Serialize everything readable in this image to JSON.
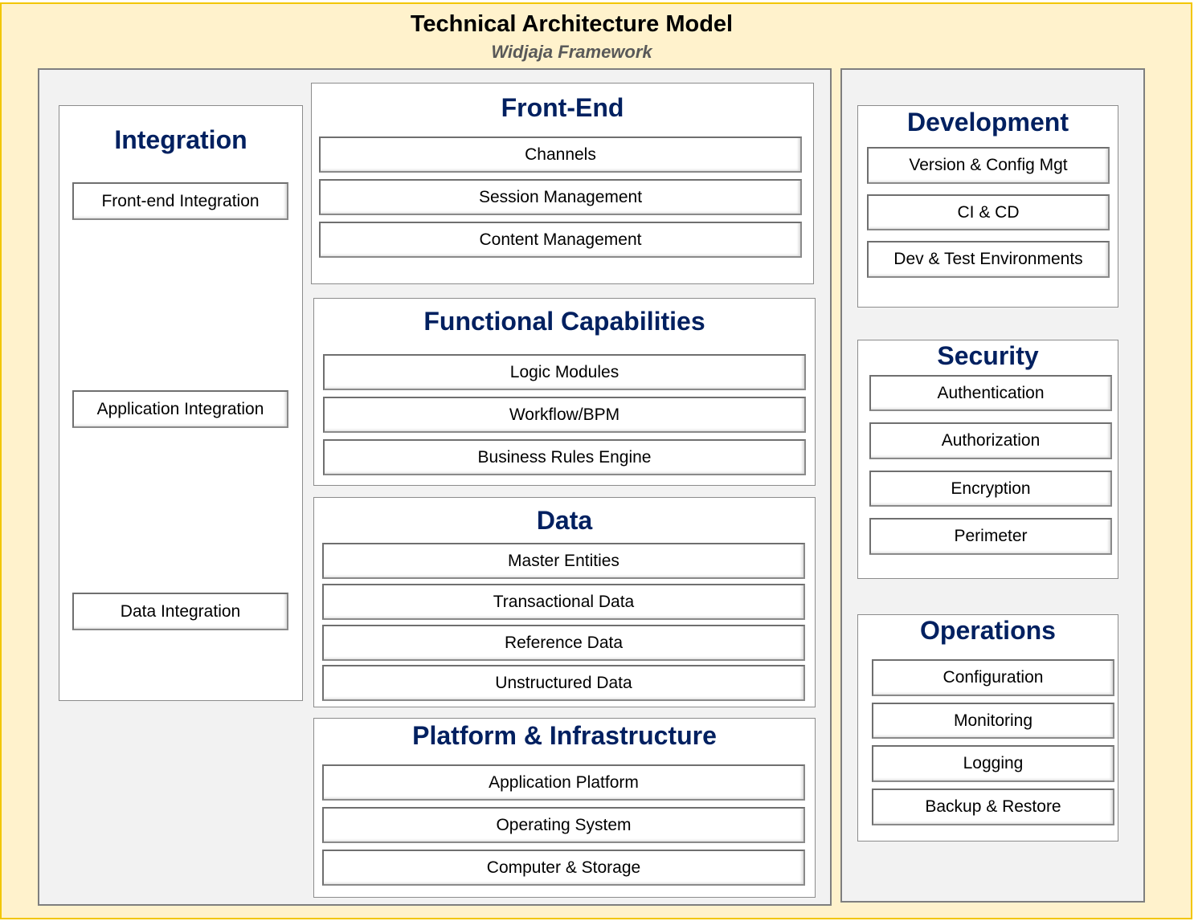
{
  "header": {
    "title": "Technical Architecture Model",
    "subtitle": "Widjaja Framework"
  },
  "colors": {
    "background": "#fff2cc",
    "border_accent": "#f2c600",
    "panel": "#f2f2f2",
    "group_title": "#002060"
  },
  "groups": {
    "integration": {
      "title": "Integration",
      "items": [
        "Front-end Integration",
        "Application Integration",
        "Data Integration"
      ]
    },
    "front_end": {
      "title": "Front-End",
      "items": [
        "Channels",
        "Session Management",
        "Content Management"
      ]
    },
    "functional": {
      "title": "Functional Capabilities",
      "items": [
        "Logic Modules",
        "Workflow/BPM",
        "Business Rules Engine"
      ]
    },
    "data": {
      "title": "Data",
      "items": [
        "Master Entities",
        "Transactional Data",
        "Reference Data",
        "Unstructured Data"
      ]
    },
    "platform": {
      "title": "Platform & Infrastructure",
      "items": [
        "Application Platform",
        "Operating System",
        "Computer & Storage"
      ]
    },
    "development": {
      "title": "Development",
      "items": [
        "Version & Config Mgt",
        "CI & CD",
        "Dev & Test Environments"
      ]
    },
    "security": {
      "title": "Security",
      "items": [
        "Authentication",
        "Authorization",
        "Encryption",
        "Perimeter"
      ]
    },
    "operations": {
      "title": "Operations",
      "items": [
        "Configuration",
        "Monitoring",
        "Logging",
        "Backup & Restore"
      ]
    }
  }
}
